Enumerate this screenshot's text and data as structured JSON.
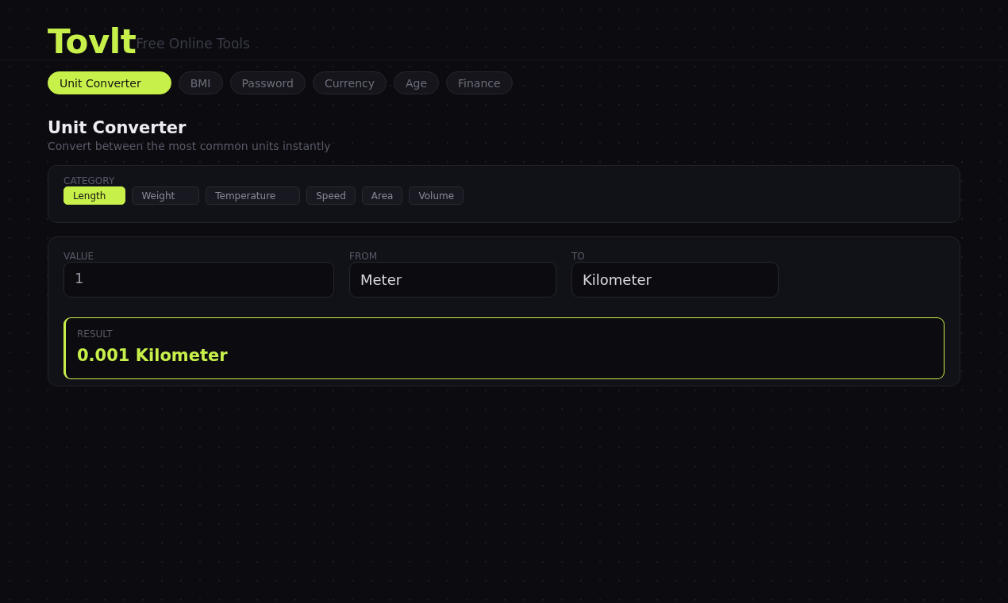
{
  "brand": {
    "name": "Tovlt",
    "tagline": "Free Online Tools"
  },
  "tabs": [
    {
      "label": "Unit Converter",
      "selected": true
    },
    {
      "label": "BMI",
      "selected": false
    },
    {
      "label": "Password",
      "selected": false
    },
    {
      "label": "Currency",
      "selected": false
    },
    {
      "label": "Age",
      "selected": false
    },
    {
      "label": "Finance",
      "selected": false
    }
  ],
  "page": {
    "title": "Unit Converter",
    "subtitle": "Convert between the most common units instantly"
  },
  "category": {
    "label": "CATEGORY",
    "options": [
      {
        "label": "Length",
        "selected": true
      },
      {
        "label": "Weight",
        "selected": false
      },
      {
        "label": "Temperature",
        "selected": false
      },
      {
        "label": "Speed",
        "selected": false
      },
      {
        "label": "Area",
        "selected": false
      },
      {
        "label": "Volume",
        "selected": false
      }
    ]
  },
  "converter": {
    "fields": [
      {
        "label": "VALUE",
        "kind": "input",
        "value": "1"
      },
      {
        "label": "FROM",
        "kind": "select",
        "value": "Meter"
      },
      {
        "label": "TO",
        "kind": "select",
        "value": "Kilometer"
      }
    ],
    "result": {
      "label": "RESULT",
      "value": "0.001 Kilometer"
    }
  }
}
